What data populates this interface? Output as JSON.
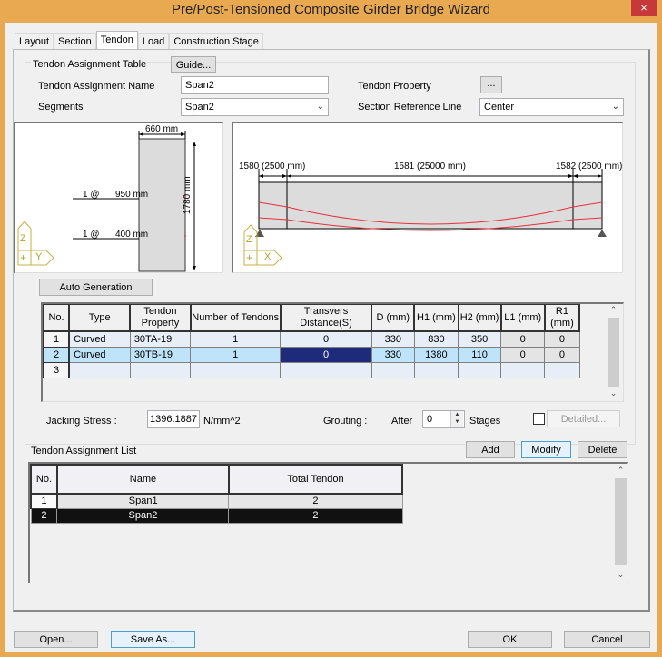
{
  "window": {
    "title": "Pre/Post-Tensioned Composite Girder Bridge Wizard",
    "close_icon": "×"
  },
  "tabs": [
    {
      "label": "Layout",
      "active": false
    },
    {
      "label": "Section",
      "active": false
    },
    {
      "label": "Tendon",
      "active": true
    },
    {
      "label": "Load",
      "active": false
    },
    {
      "label": "Construction Stage",
      "active": false
    }
  ],
  "assignment_table": {
    "group_label": "Tendon Assignment Table",
    "guide_button": "Guide...",
    "name_label": "Tendon Assignment Name",
    "name_value": "Span2",
    "tendon_property_label": "Tendon Property",
    "tendon_property_button": "...",
    "segments_label": "Segments",
    "segments_value": "Span2",
    "section_ref_label": "Section Reference Line",
    "section_ref_value": "Center"
  },
  "section_view": {
    "width_dim": "660 mm",
    "height_dim": "1780 mm",
    "tendon_labels": [
      {
        "count": "1 @",
        "offset": "950 mm"
      },
      {
        "count": "1 @",
        "offset": "400 mm"
      }
    ],
    "axis_labels": [
      "Z",
      "+",
      "Y"
    ]
  },
  "elevation_view": {
    "dims": [
      {
        "label": "1580 (2500 mm)"
      },
      {
        "label": "1581 (25000 mm)"
      },
      {
        "label": "1582 (2500 mm)"
      }
    ],
    "axis_labels": [
      "Z",
      "+",
      "X"
    ],
    "tendon_color": "#e8303c"
  },
  "auto_generation_button": "Auto Generation",
  "tendon_grid": {
    "headers": [
      "No.",
      "Type",
      "Tendon Property",
      "Number of Tendons",
      "Transvers Distance(S)",
      "D (mm)",
      "H1 (mm)",
      "H2 (mm)",
      "L1 (mm)",
      "R1 (mm)"
    ],
    "rows": [
      {
        "no": "1",
        "type": "Curved",
        "property": "30TA-19",
        "count": "1",
        "s": "0",
        "d": "330",
        "h1": "830",
        "h2": "350",
        "l1": "0",
        "r1": "0"
      },
      {
        "no": "2",
        "type": "Curved",
        "property": "30TB-19",
        "count": "1",
        "s": "0",
        "d": "330",
        "h1": "1380",
        "h2": "110",
        "l1": "0",
        "r1": "0"
      },
      {
        "no": "3",
        "type": "",
        "property": "",
        "count": "",
        "s": "",
        "d": "",
        "h1": "",
        "h2": "",
        "l1": "",
        "r1": ""
      }
    ]
  },
  "jacking": {
    "label": "Jacking Stress :",
    "value": "1396.1887",
    "unit": "N/mm^2"
  },
  "grouting": {
    "label": "Grouting :",
    "after_label": "After",
    "value": "0",
    "stages_label": "Stages",
    "detailed_button": "Detailed...",
    "checked": false
  },
  "assignment_list": {
    "label": "Tendon Assignment List",
    "add_button": "Add",
    "modify_button": "Modify",
    "delete_button": "Delete",
    "headers": [
      "No.",
      "Name",
      "Total Tendon"
    ],
    "rows": [
      {
        "no": "1",
        "name": "Span1",
        "total": "2"
      },
      {
        "no": "2",
        "name": "Span2",
        "total": "2"
      }
    ]
  },
  "footer": {
    "open_button": "Open...",
    "save_as_button": "Save As...",
    "ok_button": "OK",
    "cancel_button": "Cancel"
  }
}
